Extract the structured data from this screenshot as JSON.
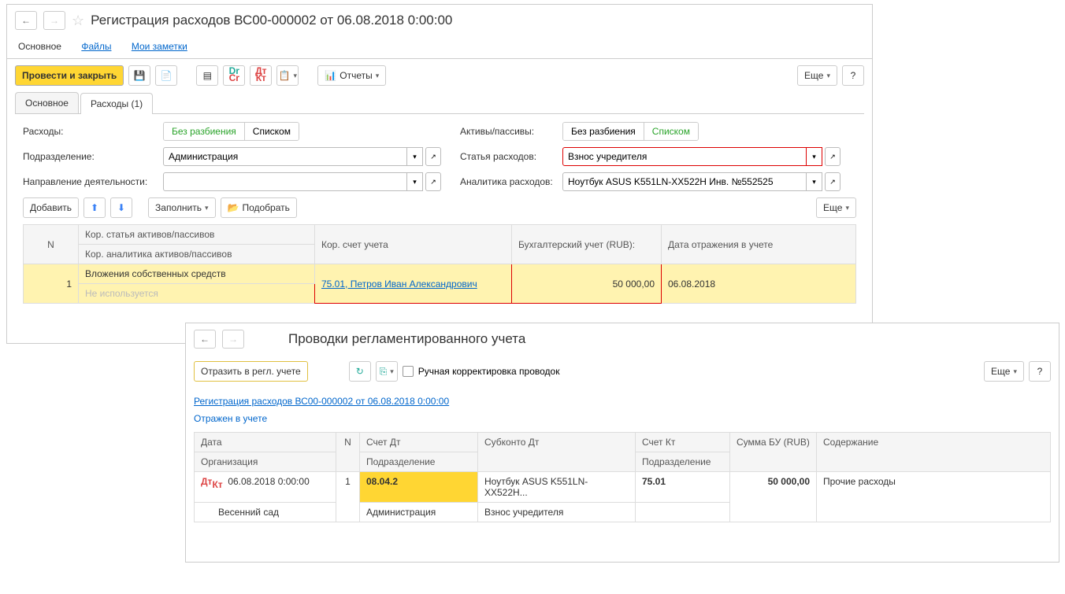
{
  "window1": {
    "title": "Регистрация расходов ВС00-000002 от 06.08.2018 0:00:00",
    "subtabs": {
      "main": "Основное",
      "files": "Файлы",
      "notes": "Мои заметки"
    },
    "toolbar": {
      "post_close": "Провести и закрыть",
      "reports": "Отчеты",
      "more": "Еще",
      "help": "?"
    },
    "tabs": {
      "main": "Основное",
      "expenses": "Расходы (1)"
    },
    "form": {
      "expenses_label": "Расходы:",
      "toggle_no_split": "Без разбиения",
      "toggle_list": "Списком",
      "assets_liab_label": "Активы/пассивы:",
      "department_label": "Подразделение:",
      "department_value": "Администрация",
      "expense_item_label": "Статья расходов:",
      "expense_item_value": "Взнос учредителя",
      "activity_label": "Направление деятельности:",
      "activity_value": "",
      "analytics_label": "Аналитика расходов:",
      "analytics_value": "Ноутбук ASUS K551LN-XX522H Инв. №552525"
    },
    "table_toolbar": {
      "add": "Добавить",
      "fill": "Заполнить",
      "pick": "Подобрать",
      "more": "Еще"
    },
    "table": {
      "headers": {
        "n": "N",
        "corr_article": "Кор. статья активов/пассивов",
        "corr_analytics": "Кор. аналитика активов/пассивов",
        "corr_account": "Кор. счет учета",
        "accounting_rub": "Бухгалтерский учет (RUB):",
        "date": "Дата отражения в учете"
      },
      "row": {
        "n": "1",
        "article": "Вложения собственных средств",
        "analytics": "Не используется",
        "account": "75.01, Петров Иван Александрович",
        "amount": "50 000,00",
        "date": "06.08.2018"
      }
    }
  },
  "window2": {
    "title": "Проводки регламентированного учета",
    "toolbar": {
      "reflect": "Отразить в регл. учете",
      "manual_checkbox": "Ручная корректировка проводок",
      "more": "Еще",
      "help": "?"
    },
    "doc_link": "Регистрация расходов ВС00-000002 от 06.08.2018 0:00:00",
    "status": "Отражен в учете",
    "table": {
      "headers": {
        "date": "Дата",
        "org": "Организация",
        "n": "N",
        "acc_dt": "Счет Дт",
        "dept_dt": "Подразделение",
        "subconto_dt": "Субконто Дт",
        "acc_kt": "Счет Кт",
        "dept_kt": "Подразделение",
        "sum": "Сумма БУ (RUB)",
        "content": "Содержание"
      },
      "row": {
        "date": "06.08.2018 0:00:00",
        "org": "Весенний сад",
        "n": "1",
        "acc_dt": "08.04.2",
        "dept_dt": "Администрация",
        "subconto1": "Ноутбук ASUS K551LN-XX522H...",
        "subconto2": "Взнос учредителя",
        "acc_kt": "75.01",
        "sum": "50 000,00",
        "content": "Прочие расходы"
      }
    }
  }
}
